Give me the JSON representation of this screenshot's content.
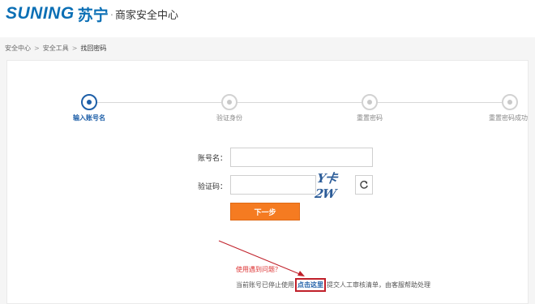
{
  "header": {
    "logo_latin": "SUNING",
    "logo_chinese": "苏宁",
    "logo_dot": "·",
    "subtitle": "商家安全中心"
  },
  "breadcrumb": [
    "安全中心",
    "安全工具",
    "找回密码"
  ],
  "breadcrumb_sep": ">",
  "steps": [
    {
      "label": "输入账号名",
      "state": "active"
    },
    {
      "label": "验证身份",
      "state": "inactive"
    },
    {
      "label": "重置密码",
      "state": "inactive"
    },
    {
      "label": "重置密码成功",
      "state": "inactive"
    }
  ],
  "form": {
    "account_label": "账号名：",
    "account_value": "",
    "captcha_label": "验证码：",
    "captcha_value": "",
    "captcha_text": "Y卡2W",
    "next_button": "下一步"
  },
  "help": {
    "question": "使用遇到问题？",
    "line_prefix": "当前账号已停止使用",
    "link": "点击这里",
    "line_suffix": "提交人工审核清单，由客服帮助处理"
  },
  "colors": {
    "brand_blue": "#0b6fb5",
    "step_active": "#1e5fa8",
    "next_button": "#f57b21",
    "annotation_red": "#c0202a"
  },
  "icons": {
    "refresh": "refresh-icon",
    "annotation_arrow": "arrow-annotation"
  }
}
